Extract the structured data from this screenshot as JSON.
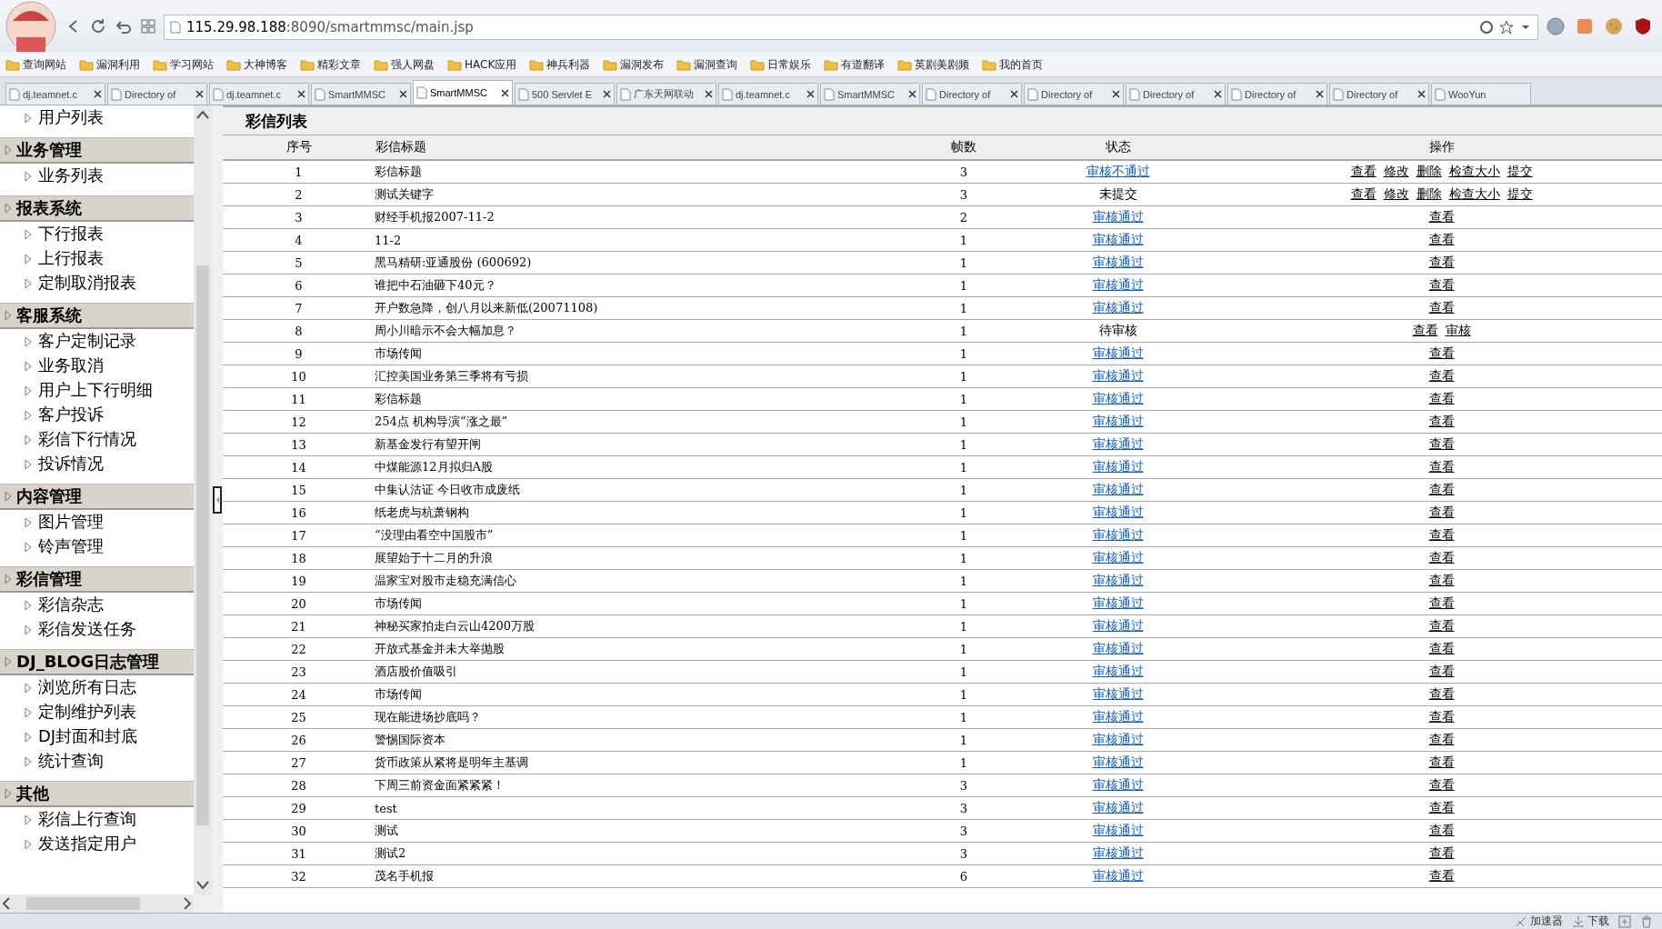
{
  "browser": {
    "address": {
      "host": "115.29.98.188",
      "path": ":8090/smartmmsc/main.jsp"
    },
    "bookmarks": [
      "查询网站",
      "漏洞利用",
      "学习网站",
      "大神博客",
      "精彩文章",
      "强人网盘",
      "HACK应用",
      "神兵利器",
      "漏洞发布",
      "漏洞查询",
      "日常娱乐",
      "有道翻译",
      "英剧美剧频",
      "我的首页"
    ],
    "tabs": [
      {
        "label": "dj.teamnet.c",
        "selected": false
      },
      {
        "label": "Directory of",
        "selected": false
      },
      {
        "label": "dj.teamnet.c",
        "selected": false
      },
      {
        "label": "SmartMMSC",
        "selected": false
      },
      {
        "label": "SmartMMSC",
        "selected": true
      },
      {
        "label": "500 Servlet E",
        "selected": false
      },
      {
        "label": "广东天网联动",
        "selected": false
      },
      {
        "label": "dj.teamnet.c",
        "selected": false
      },
      {
        "label": "SmartMMSC",
        "selected": false
      },
      {
        "label": "Directory of",
        "selected": false
      },
      {
        "label": "Directory of",
        "selected": false
      },
      {
        "label": "Directory of",
        "selected": false
      },
      {
        "label": "Directory of",
        "selected": false
      },
      {
        "label": "Directory of",
        "selected": false
      },
      {
        "label": "WooYun",
        "selected": false
      }
    ]
  },
  "sidebar": {
    "items": [
      {
        "label": "用户列表"
      },
      {
        "label": "业务管理",
        "children": [
          {
            "label": "业务列表"
          }
        ]
      },
      {
        "label": "报表系统",
        "children": [
          {
            "label": "下行报表"
          },
          {
            "label": "上行报表"
          },
          {
            "label": "定制取消报表"
          }
        ]
      },
      {
        "label": "客服系统",
        "children": [
          {
            "label": "客户定制记录"
          },
          {
            "label": "业务取消"
          },
          {
            "label": "用户上下行明细"
          },
          {
            "label": "客户投诉"
          },
          {
            "label": "彩信下行情况"
          },
          {
            "label": "投诉情况"
          }
        ]
      },
      {
        "label": "内容管理",
        "children": [
          {
            "label": "图片管理"
          },
          {
            "label": "铃声管理"
          }
        ]
      },
      {
        "label": "彩信管理",
        "children": [
          {
            "label": "彩信杂志"
          },
          {
            "label": "彩信发送任务"
          }
        ]
      },
      {
        "label": "DJ_BLOG日志管理",
        "children": [
          {
            "label": "浏览所有日志"
          },
          {
            "label": "定制维护列表"
          },
          {
            "label": "DJ封面和封底"
          },
          {
            "label": "统计查询"
          }
        ]
      },
      {
        "label": "其他",
        "children": [
          {
            "label": "彩信上行查询"
          },
          {
            "label": "发送指定用户"
          }
        ]
      }
    ]
  },
  "table": {
    "title": "彩信列表",
    "columns": [
      "序号",
      "彩信标题",
      "帧数",
      "状态",
      "操作"
    ],
    "rows": [
      {
        "no": "1",
        "title": "彩信标题",
        "frames": "3",
        "status": {
          "text": "审核不通过",
          "kind": "link"
        },
        "actions": [
          "查看",
          "修改",
          "删除",
          "检查大小",
          "提交"
        ]
      },
      {
        "no": "2",
        "title": "测试关键字",
        "frames": "3",
        "status": {
          "text": "未提交",
          "kind": "text"
        },
        "actions": [
          "查看",
          "修改",
          "删除",
          "检查大小",
          "提交"
        ]
      },
      {
        "no": "3",
        "title": "财经手机报2007-11-2",
        "frames": "2",
        "status": {
          "text": "审核通过",
          "kind": "link"
        },
        "actions": [
          "查看"
        ]
      },
      {
        "no": "4",
        "title": "11-2",
        "frames": "1",
        "status": {
          "text": "审核通过",
          "kind": "link"
        },
        "actions": [
          "查看"
        ]
      },
      {
        "no": "5",
        "title": "黑马精研:亚通股份 (600692)",
        "frames": "1",
        "status": {
          "text": "审核通过",
          "kind": "link"
        },
        "actions": [
          "查看"
        ]
      },
      {
        "no": "6",
        "title": "谁把中石油砸下40元？",
        "frames": "1",
        "status": {
          "text": "审核通过",
          "kind": "link"
        },
        "actions": [
          "查看"
        ]
      },
      {
        "no": "7",
        "title": "开户数急降，创八月以来新低(20071108)",
        "frames": "1",
        "status": {
          "text": "审核通过",
          "kind": "link"
        },
        "actions": [
          "查看"
        ]
      },
      {
        "no": "8",
        "title": "周小川暗示不会大幅加息？",
        "frames": "1",
        "status": {
          "text": "待审核",
          "kind": "text"
        },
        "actions": [
          "查看",
          "审核"
        ]
      },
      {
        "no": "9",
        "title": "市场传闻",
        "frames": "1",
        "status": {
          "text": "审核通过",
          "kind": "link"
        },
        "actions": [
          "查看"
        ]
      },
      {
        "no": "10",
        "title": "汇控美国业务第三季将有亏损",
        "frames": "1",
        "status": {
          "text": "审核通过",
          "kind": "link"
        },
        "actions": [
          "查看"
        ]
      },
      {
        "no": "11",
        "title": "彩信标题",
        "frames": "1",
        "status": {
          "text": "审核通过",
          "kind": "link"
        },
        "actions": [
          "查看"
        ]
      },
      {
        "no": "12",
        "title": "254点 机构导演“涨之最”",
        "frames": "1",
        "status": {
          "text": "审核通过",
          "kind": "link"
        },
        "actions": [
          "查看"
        ]
      },
      {
        "no": "13",
        "title": "新基金发行有望开闸",
        "frames": "1",
        "status": {
          "text": "审核通过",
          "kind": "link"
        },
        "actions": [
          "查看"
        ]
      },
      {
        "no": "14",
        "title": "中煤能源12月拟归A股",
        "frames": "1",
        "status": {
          "text": "审核通过",
          "kind": "link"
        },
        "actions": [
          "查看"
        ]
      },
      {
        "no": "15",
        "title": "中集认沽证 今日收市成废纸",
        "frames": "1",
        "status": {
          "text": "审核通过",
          "kind": "link"
        },
        "actions": [
          "查看"
        ]
      },
      {
        "no": "16",
        "title": "纸老虎与杭萧钢构",
        "frames": "1",
        "status": {
          "text": "审核通过",
          "kind": "link"
        },
        "actions": [
          "查看"
        ]
      },
      {
        "no": "17",
        "title": "“没理由看空中国股市”",
        "frames": "1",
        "status": {
          "text": "审核通过",
          "kind": "link"
        },
        "actions": [
          "查看"
        ]
      },
      {
        "no": "18",
        "title": "展望始于十二月的升浪",
        "frames": "1",
        "status": {
          "text": "审核通过",
          "kind": "link"
        },
        "actions": [
          "查看"
        ]
      },
      {
        "no": "19",
        "title": "温家宝对股市走稳充满信心",
        "frames": "1",
        "status": {
          "text": "审核通过",
          "kind": "link"
        },
        "actions": [
          "查看"
        ]
      },
      {
        "no": "20",
        "title": "市场传闻",
        "frames": "1",
        "status": {
          "text": "审核通过",
          "kind": "link"
        },
        "actions": [
          "查看"
        ]
      },
      {
        "no": "21",
        "title": "神秘买家拍走白云山4200万股",
        "frames": "1",
        "status": {
          "text": "审核通过",
          "kind": "link"
        },
        "actions": [
          "查看"
        ]
      },
      {
        "no": "22",
        "title": "开放式基金并未大举抛股",
        "frames": "1",
        "status": {
          "text": "审核通过",
          "kind": "link"
        },
        "actions": [
          "查看"
        ]
      },
      {
        "no": "23",
        "title": "酒店股价值吸引",
        "frames": "1",
        "status": {
          "text": "审核通过",
          "kind": "link"
        },
        "actions": [
          "查看"
        ]
      },
      {
        "no": "24",
        "title": "市场传闻",
        "frames": "1",
        "status": {
          "text": "审核通过",
          "kind": "link"
        },
        "actions": [
          "查看"
        ]
      },
      {
        "no": "25",
        "title": "现在能进场抄底吗？",
        "frames": "1",
        "status": {
          "text": "审核通过",
          "kind": "link"
        },
        "actions": [
          "查看"
        ]
      },
      {
        "no": "26",
        "title": "警惕国际资本",
        "frames": "1",
        "status": {
          "text": "审核通过",
          "kind": "link"
        },
        "actions": [
          "查看"
        ]
      },
      {
        "no": "27",
        "title": "货币政策从紧将是明年主基调",
        "frames": "1",
        "status": {
          "text": "审核通过",
          "kind": "link"
        },
        "actions": [
          "查看"
        ]
      },
      {
        "no": "28",
        "title": "下周三前资金面紧紧紧！",
        "frames": "3",
        "status": {
          "text": "审核通过",
          "kind": "link"
        },
        "actions": [
          "查看"
        ]
      },
      {
        "no": "29",
        "title": "test",
        "frames": "3",
        "status": {
          "text": "审核通过",
          "kind": "link"
        },
        "actions": [
          "查看"
        ]
      },
      {
        "no": "30",
        "title": "测试",
        "frames": "3",
        "status": {
          "text": "审核通过",
          "kind": "link"
        },
        "actions": [
          "查看"
        ]
      },
      {
        "no": "31",
        "title": "测试2",
        "frames": "3",
        "status": {
          "text": "审核通过",
          "kind": "link"
        },
        "actions": [
          "查看"
        ]
      },
      {
        "no": "32",
        "title": "茂名手机报",
        "frames": "6",
        "status": {
          "text": "审核通过",
          "kind": "link"
        },
        "actions": [
          "查看"
        ]
      }
    ]
  },
  "status_bar": {
    "items": [
      "加速器",
      "下载"
    ]
  }
}
